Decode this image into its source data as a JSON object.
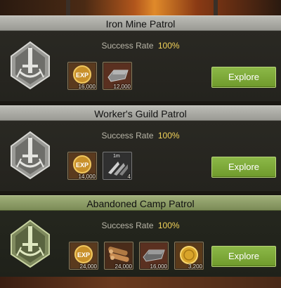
{
  "success_label": "Success Rate",
  "explore_label": "Explore",
  "patrols": [
    {
      "title": "Iron Mine Patrol",
      "success_rate": "100%",
      "rewards": [
        {
          "icon": "exp-icon",
          "amount": "16,000"
        },
        {
          "icon": "iron-ingot-icon",
          "amount": "12,000"
        }
      ]
    },
    {
      "title": "Worker's Guild Patrol",
      "success_rate": "100%",
      "rewards": [
        {
          "icon": "exp-icon",
          "amount": "14,000"
        },
        {
          "icon": "speedup-icon",
          "amount": "4",
          "badge": "1m"
        }
      ]
    },
    {
      "title": "Abandoned Camp Patrol",
      "success_rate": "100%",
      "selected": true,
      "rewards": [
        {
          "icon": "exp-icon",
          "amount": "24,000"
        },
        {
          "icon": "wood-logs-icon",
          "amount": "24,000"
        },
        {
          "icon": "iron-ingot-icon",
          "amount": "16,000"
        },
        {
          "icon": "gold-coin-icon",
          "amount": "3,200"
        }
      ]
    }
  ],
  "colors": {
    "accent_rate": "#f2d35a",
    "explore_button": "#7aa83a",
    "title_bar": "#aaaaa4",
    "title_bar_selected": "#8e9e66"
  }
}
